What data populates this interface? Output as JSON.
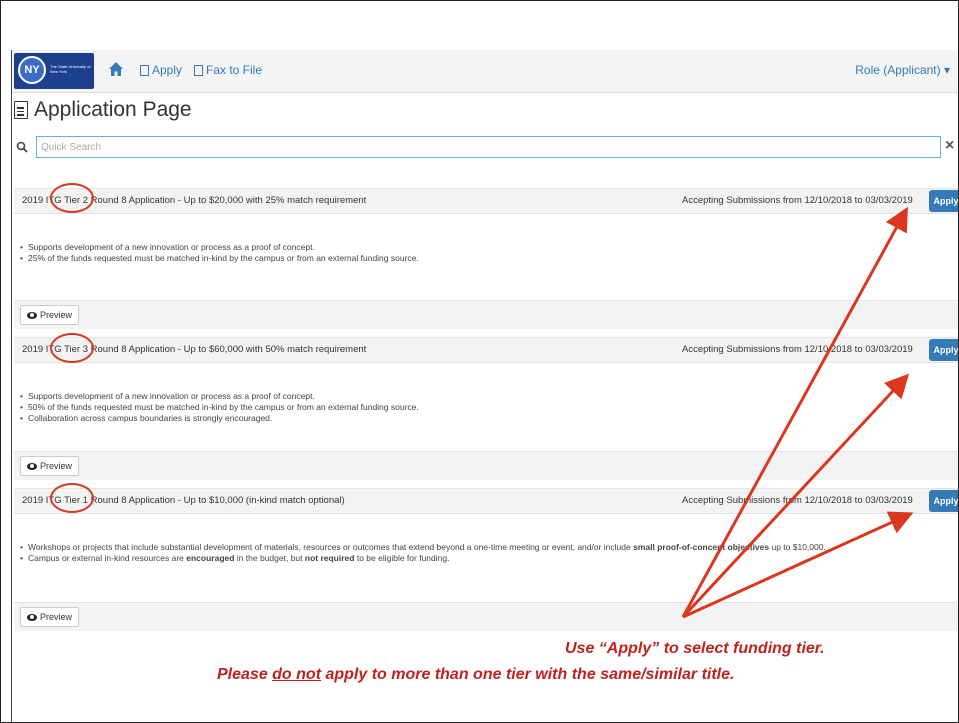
{
  "navbar": {
    "logo_initials": "NY",
    "logo_text": "The State University of New York",
    "nav_items": [
      {
        "label": "Apply"
      },
      {
        "label": "Fax to File"
      }
    ],
    "role": "Role (Applicant) ▾"
  },
  "page_title": "Application Page",
  "search": {
    "placeholder": "Quick Search",
    "clear_label": "×"
  },
  "tiers": [
    {
      "title": "2019 ITG Tier 2 Round 8 Application - Up to $20,000 with 25% match requirement",
      "dates": "Accepting Submissions from 12/10/2018 to 03/03/2019",
      "apply_label": "Apply",
      "preview_label": "Preview",
      "bullets": [
        "Supports development of a new innovation or process as a proof of concept.",
        "25% of the funds requested must be matched in-kind by the campus or from an external funding source."
      ]
    },
    {
      "title": "2019 ITG Tier 3 Round 8 Application - Up to $60,000 with 50% match requirement",
      "dates": "Accepting Submissions from 12/10/2018 to 03/03/2019",
      "apply_label": "Apply",
      "preview_label": "Preview",
      "bullets": [
        "Supports development of a new innovation or process as a proof of concept.",
        "50% of the funds requested must be matched in-kind by the campus or from an external funding source.",
        "Collaboration across campus boundaries is strongly encouraged."
      ]
    },
    {
      "title": "2019 ITG Tier 1 Round 8 Application - Up to $10,000 (in-kind match optional)",
      "dates": "Accepting Submissions from 12/10/2018 to 03/03/2019",
      "apply_label": "Apply",
      "preview_label": "Preview",
      "bullets_rich": [
        {
          "pre": "Workshops or projects that include substantial development of materials, resources or outcomes that extend beyond a one-time meeting or event, and/or include ",
          "bold": "small proof-of-concept objectives",
          "post": " up to $10,000."
        },
        {
          "pre": "Campus or external in-kind resources are ",
          "bold": "encouraged",
          "mid": " in the budget, but ",
          "bold2": "not required",
          "post": " to be eligible for funding."
        }
      ]
    }
  ],
  "callout": {
    "line1": "Use “Apply” to select funding tier.",
    "line2_pre": "Please ",
    "line2_underlined": "do not",
    "line2_post": " apply to more than one tier with the same/similar title."
  },
  "colors": {
    "accent": "#337ab7",
    "annotation": "#d9381e"
  }
}
